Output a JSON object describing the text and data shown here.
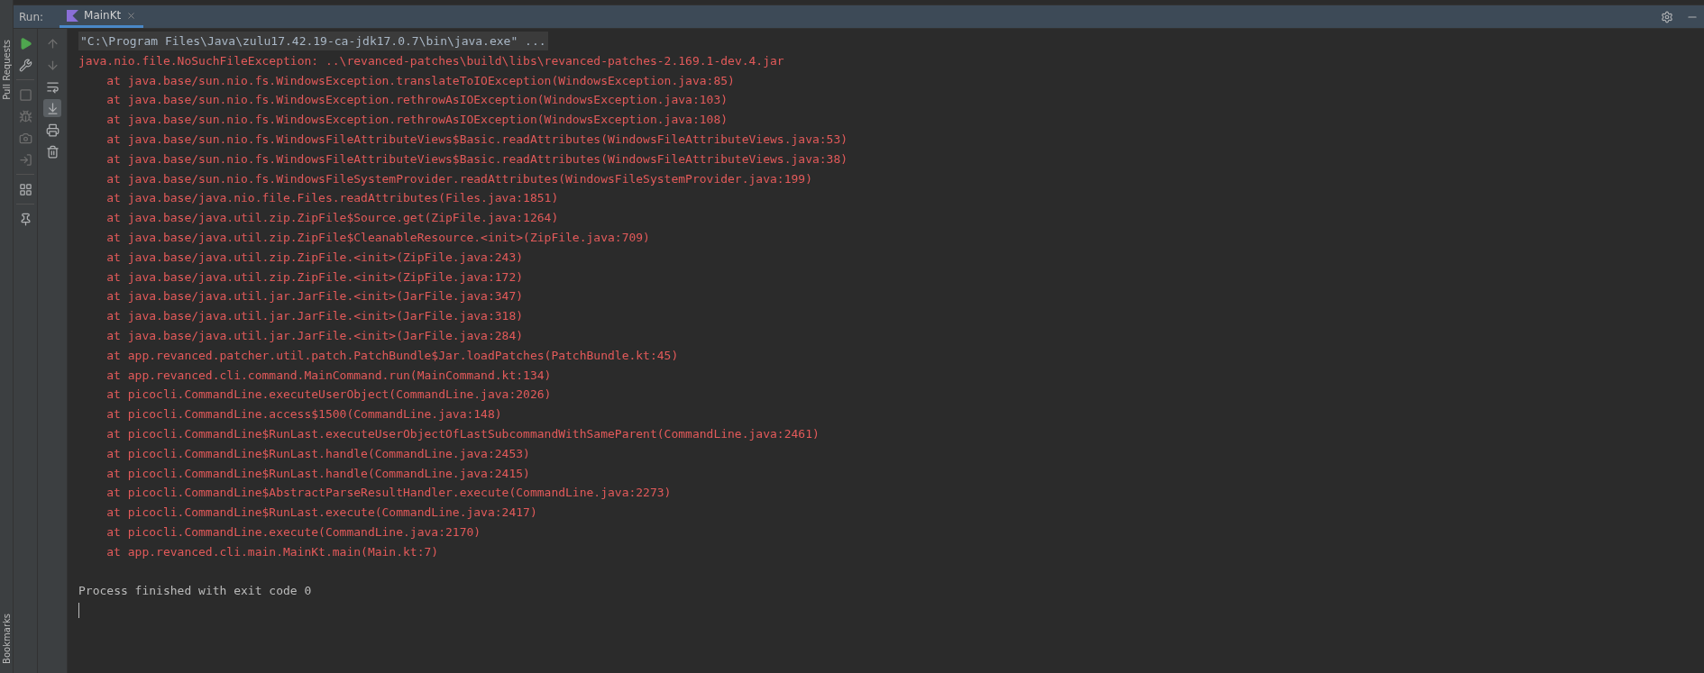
{
  "side_stripe": {
    "top_label": "Pull Requests",
    "bottom_label": "Bookmarks"
  },
  "run_header": {
    "label": "Run:",
    "tabs": [
      {
        "label": "MainKt",
        "selected": true
      }
    ]
  },
  "left_toolbar": [
    {
      "kind": "rerun",
      "disabled": false
    },
    {
      "kind": "settings",
      "disabled": false
    },
    {
      "kind": "separator",
      "disabled": false
    },
    {
      "kind": "stop",
      "disabled": true
    },
    {
      "kind": "debug",
      "disabled": true
    },
    {
      "kind": "snapshot",
      "disabled": true
    },
    {
      "kind": "attach",
      "disabled": true
    },
    {
      "kind": "separator",
      "disabled": false
    },
    {
      "kind": "layout",
      "disabled": false
    },
    {
      "kind": "separator",
      "disabled": false
    },
    {
      "kind": "pin",
      "disabled": false
    }
  ],
  "console_toolbar": [
    {
      "kind": "up",
      "disabled": true,
      "on": false
    },
    {
      "kind": "down",
      "disabled": true,
      "on": false
    },
    {
      "kind": "wrap",
      "disabled": false,
      "on": false
    },
    {
      "kind": "scroll_end",
      "disabled": false,
      "on": true
    },
    {
      "kind": "print",
      "disabled": false,
      "on": false
    },
    {
      "kind": "clear",
      "disabled": false,
      "on": false
    }
  ],
  "console": [
    {
      "kind": "command",
      "text": "\"C:\\Program Files\\Java\\zulu17.42.19-ca-jdk17.0.7\\bin\\java.exe\" ..."
    },
    {
      "kind": "error",
      "text": "java.nio.file.NoSuchFileException: ..\\revanced-patches\\build\\libs\\revanced-patches-2.169.1-dev.4.jar"
    },
    {
      "kind": "frame",
      "text": "at java.base/sun.nio.fs.WindowsException.translateToIOException(WindowsException.java:85)"
    },
    {
      "kind": "frame",
      "text": "at java.base/sun.nio.fs.WindowsException.rethrowAsIOException(WindowsException.java:103)"
    },
    {
      "kind": "frame",
      "text": "at java.base/sun.nio.fs.WindowsException.rethrowAsIOException(WindowsException.java:108)"
    },
    {
      "kind": "frame",
      "text": "at java.base/sun.nio.fs.WindowsFileAttributeViews$Basic.readAttributes(WindowsFileAttributeViews.java:53)"
    },
    {
      "kind": "frame",
      "text": "at java.base/sun.nio.fs.WindowsFileAttributeViews$Basic.readAttributes(WindowsFileAttributeViews.java:38)"
    },
    {
      "kind": "frame",
      "text": "at java.base/sun.nio.fs.WindowsFileSystemProvider.readAttributes(WindowsFileSystemProvider.java:199)"
    },
    {
      "kind": "frame",
      "text": "at java.base/java.nio.file.Files.readAttributes(Files.java:1851)"
    },
    {
      "kind": "frame",
      "text": "at java.base/java.util.zip.ZipFile$Source.get(ZipFile.java:1264)"
    },
    {
      "kind": "frame",
      "text": "at java.base/java.util.zip.ZipFile$CleanableResource.<init>(ZipFile.java:709)"
    },
    {
      "kind": "frame",
      "text": "at java.base/java.util.zip.ZipFile.<init>(ZipFile.java:243)"
    },
    {
      "kind": "frame",
      "text": "at java.base/java.util.zip.ZipFile.<init>(ZipFile.java:172)"
    },
    {
      "kind": "frame",
      "text": "at java.base/java.util.jar.JarFile.<init>(JarFile.java:347)"
    },
    {
      "kind": "frame",
      "text": "at java.base/java.util.jar.JarFile.<init>(JarFile.java:318)"
    },
    {
      "kind": "frame",
      "text": "at java.base/java.util.jar.JarFile.<init>(JarFile.java:284)"
    },
    {
      "kind": "frame",
      "text": "at app.revanced.patcher.util.patch.PatchBundle$Jar.loadPatches(PatchBundle.kt:45)"
    },
    {
      "kind": "frame",
      "text": "at app.revanced.cli.command.MainCommand.run(MainCommand.kt:134)"
    },
    {
      "kind": "frame",
      "text": "at picocli.CommandLine.executeUserObject(CommandLine.java:2026)"
    },
    {
      "kind": "frame",
      "text": "at picocli.CommandLine.access$1500(CommandLine.java:148)"
    },
    {
      "kind": "frame",
      "text": "at picocli.CommandLine$RunLast.executeUserObjectOfLastSubcommandWithSameParent(CommandLine.java:2461)"
    },
    {
      "kind": "frame",
      "text": "at picocli.CommandLine$RunLast.handle(CommandLine.java:2453)"
    },
    {
      "kind": "frame",
      "text": "at picocli.CommandLine$RunLast.handle(CommandLine.java:2415)"
    },
    {
      "kind": "frame",
      "text": "at picocli.CommandLine$AbstractParseResultHandler.execute(CommandLine.java:2273)"
    },
    {
      "kind": "frame",
      "text": "at picocli.CommandLine$RunLast.execute(CommandLine.java:2417)"
    },
    {
      "kind": "frame",
      "text": "at picocli.CommandLine.execute(CommandLine.java:2170)"
    },
    {
      "kind": "frame",
      "text": "at app.revanced.cli.main.MainKt.main(Main.kt:7)"
    },
    {
      "kind": "blank"
    },
    {
      "kind": "info",
      "text": "Process finished with exit code 0"
    },
    {
      "kind": "cursor"
    }
  ]
}
